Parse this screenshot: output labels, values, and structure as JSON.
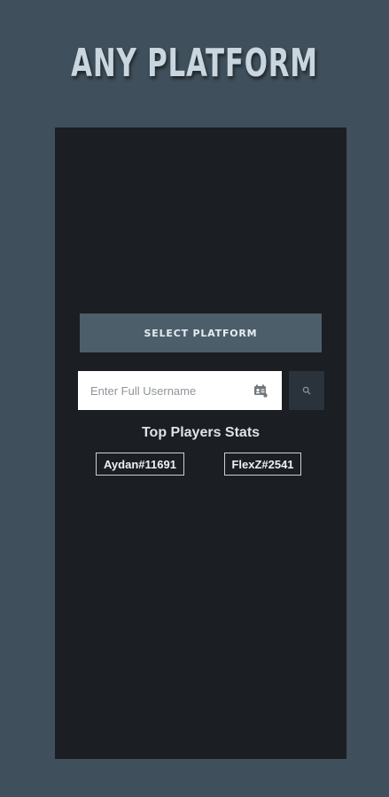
{
  "header": {
    "title": "ANY PLATFORM"
  },
  "form": {
    "select_platform_label": "SELECT PLATFORM",
    "username_placeholder": "Enter Full Username",
    "username_value": "",
    "card_icon": "contact-card-icon",
    "search_icon": "search-icon"
  },
  "top_players": {
    "heading": "Top Players Stats",
    "players": [
      {
        "name": "Aydan#11691"
      },
      {
        "name": "FlexZ#2541"
      }
    ]
  },
  "colors": {
    "page_background": "#3f4f5b",
    "panel_background": "#1b1e22",
    "button_background": "#4d5e6b",
    "search_button_background": "#2a333b"
  }
}
